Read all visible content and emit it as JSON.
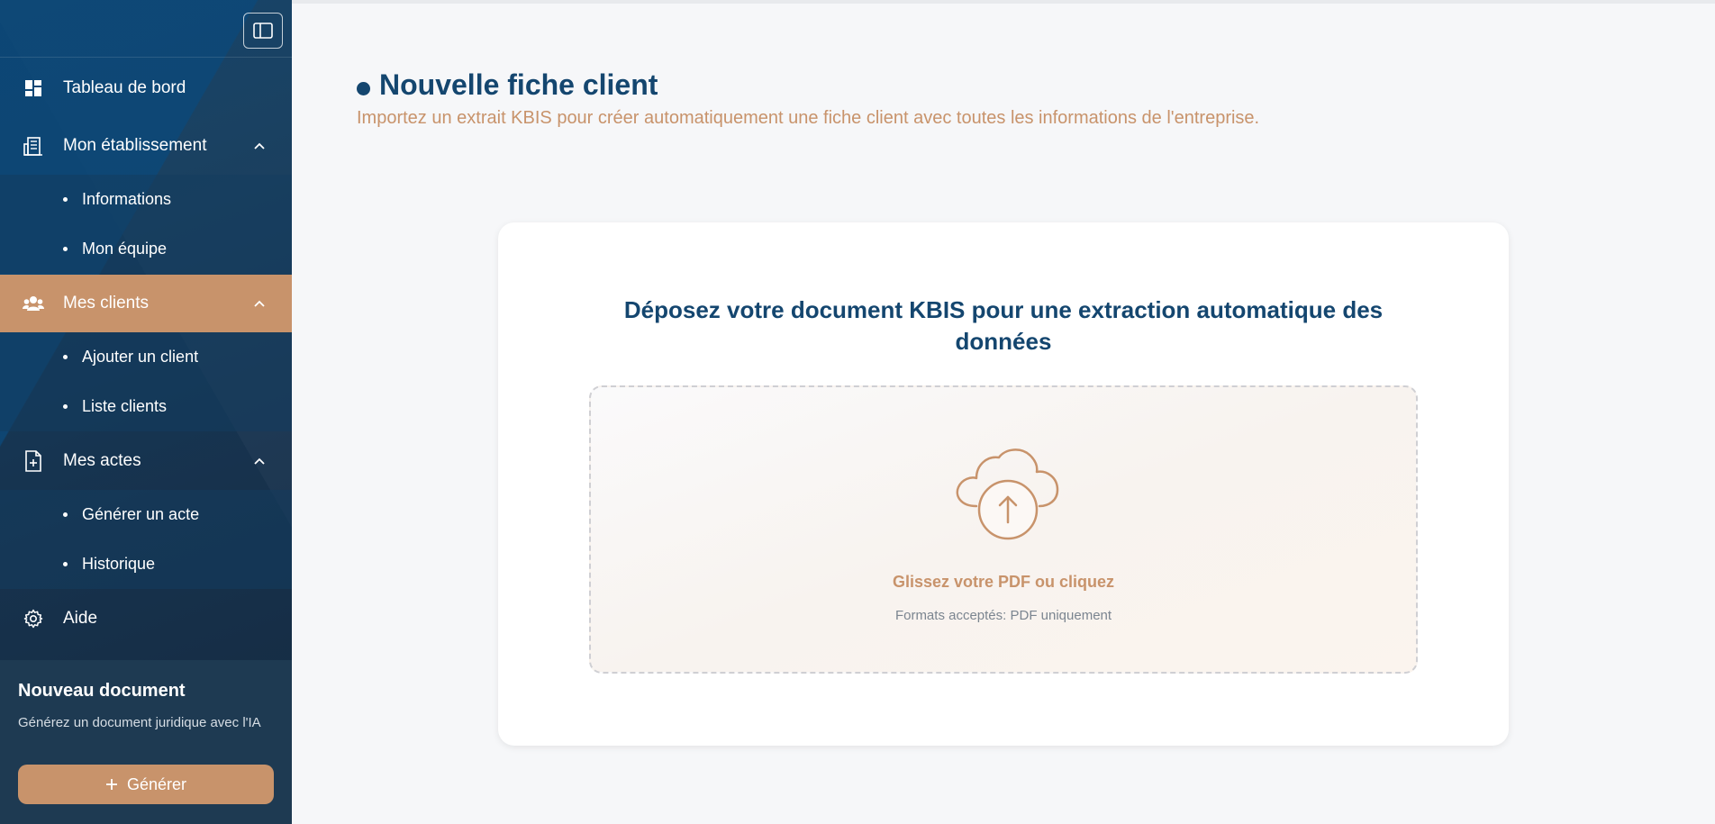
{
  "sidebar": {
    "items": [
      {
        "label": "Tableau de bord",
        "icon": "dashboard-icon"
      },
      {
        "label": "Mon établissement",
        "icon": "building-icon"
      },
      {
        "label": "Mes clients",
        "icon": "users-icon"
      },
      {
        "label": "Mes actes",
        "icon": "file-plus-icon"
      },
      {
        "label": "Aide",
        "icon": "gear-icon"
      }
    ],
    "etablissement_sub": [
      "Informations",
      "Mon équipe"
    ],
    "clients_sub": [
      "Ajouter un client",
      "Liste clients"
    ],
    "actes_sub": [
      "Générer un acte",
      "Historique"
    ],
    "new_doc": {
      "title": "Nouveau document",
      "description": "Générez un document juridique avec l'IA",
      "button_label": "Générer"
    },
    "active_color": "#c8936b"
  },
  "main": {
    "title": "Nouvelle fiche client",
    "subtitle": "Importez un extrait KBIS pour créer automatiquement une fiche client avec toutes les informations de l'entreprise.",
    "card_heading": "Déposez votre document KBIS pour une extraction automatique des données",
    "dropzone": {
      "main_text": "Glissez votre PDF ou cliquez",
      "sub_text": "Formats acceptés: PDF uniquement",
      "icon": "cloud-upload-icon"
    }
  },
  "colors": {
    "primary": "#14466f",
    "accent": "#c8936b"
  }
}
